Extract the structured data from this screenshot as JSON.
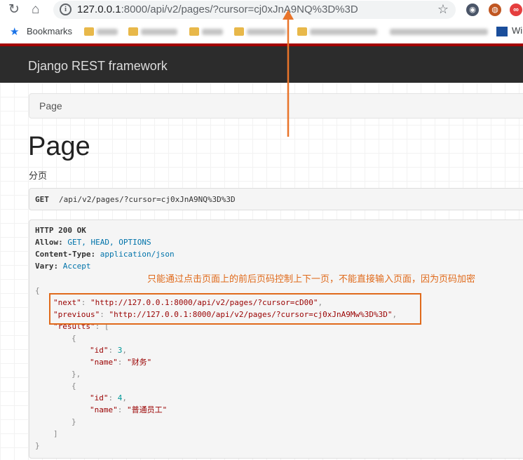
{
  "browser": {
    "url_main": "127.0.0.1",
    "url_rest": ":8000/api/v2/pages/?cursor=cj0xJnA9NQ%3D%3D",
    "bookmarks_label": "Bookmarks",
    "wiki_label": "Wi"
  },
  "navbar": {
    "brand": "Django REST framework"
  },
  "breadcrumb": {
    "label": "Page"
  },
  "page": {
    "title": "Page",
    "description": "分页"
  },
  "request": {
    "method": "GET",
    "path": "/api/v2/pages/?cursor=cj0xJnA9NQ%3D%3D"
  },
  "response": {
    "status": "HTTP 200 OK",
    "headers": [
      {
        "key": "Allow:",
        "value": "GET, HEAD, OPTIONS"
      },
      {
        "key": "Content-Type:",
        "value": "application/json"
      },
      {
        "key": "Vary:",
        "value": "Accept"
      }
    ],
    "next_key": "\"next\"",
    "next_val": "\"http://127.0.0.1:8000/api/v2/pages/?cursor=cD00\"",
    "previous_key": "\"previous\"",
    "previous_val": "\"http://127.0.0.1:8000/api/v2/pages/?cursor=cj0xJnA9Mw%3D%3D\"",
    "results_key": "\"results\"",
    "items": [
      {
        "id_key": "\"id\"",
        "id": "3",
        "name_key": "\"name\"",
        "name": "\"财务\""
      },
      {
        "id_key": "\"id\"",
        "id": "4",
        "name_key": "\"name\"",
        "name": "\"普通员工\""
      }
    ]
  },
  "annotation": "只能通过点击页面上的前后页码控制上下一页，不能直接输入页面，因为页码加密",
  "colors": {
    "accent": "#e06a1b",
    "navbar": "#2c2c2c",
    "navbar_border": "#a30000"
  }
}
